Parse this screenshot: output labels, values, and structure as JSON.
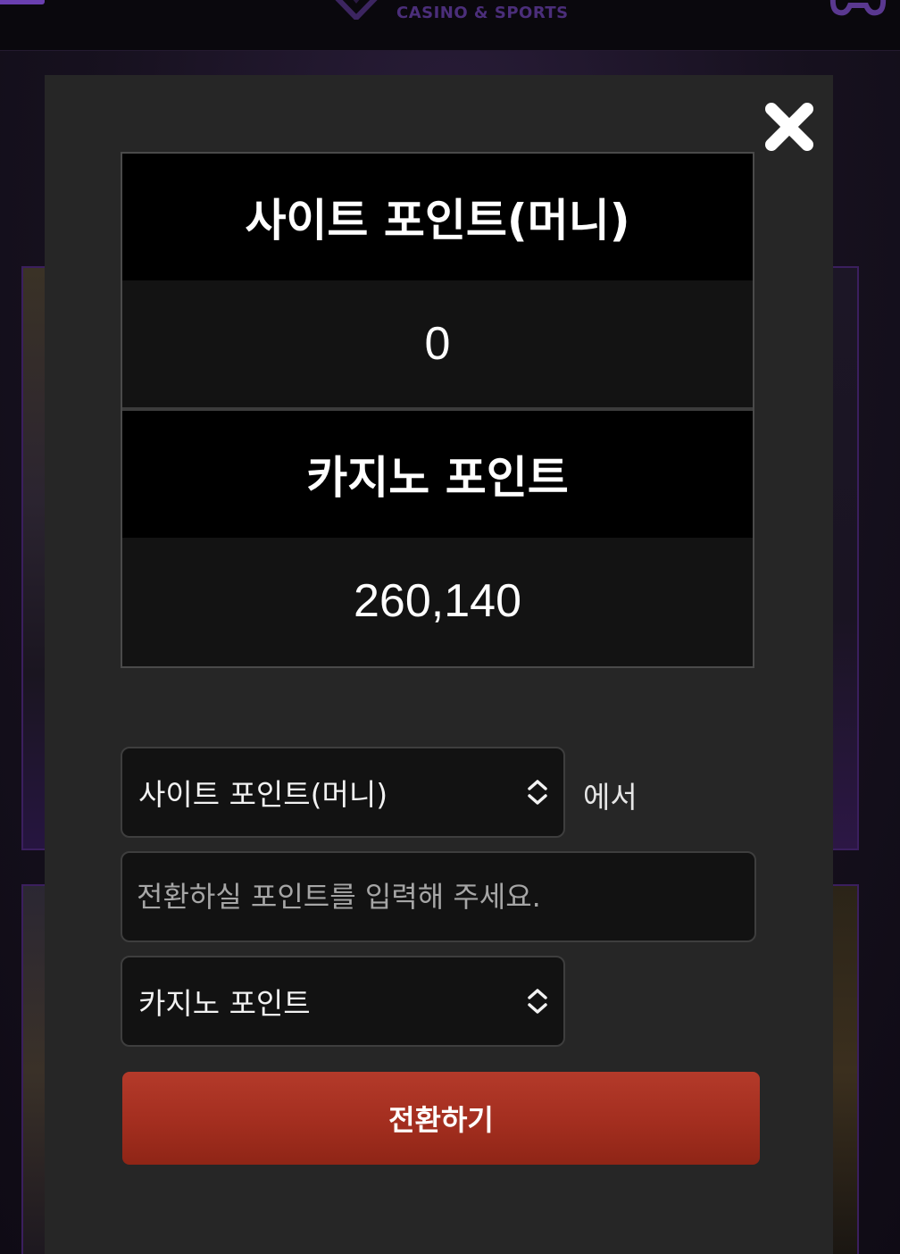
{
  "header": {
    "logo_text": "CASINO & SPORTS",
    "menu_icon": "hamburger-menu-icon",
    "gamepad_icon": "gamepad-icon",
    "accent_color": "#6a3fb0"
  },
  "modal": {
    "close_icon": "close-icon",
    "site_points": {
      "label": "사이트 포인트(머니)",
      "value": "0"
    },
    "casino_points": {
      "label": "카지노 포인트",
      "value": "260,140"
    },
    "from_select": {
      "selected": "사이트 포인트(머니)",
      "suffix": "에서"
    },
    "amount_input": {
      "value": "",
      "placeholder": "전환하실 포인트를 입력해 주세요."
    },
    "to_select": {
      "selected": "카지노 포인트"
    },
    "convert_button": {
      "label": "전환하기",
      "color": "#a32e1f"
    }
  }
}
